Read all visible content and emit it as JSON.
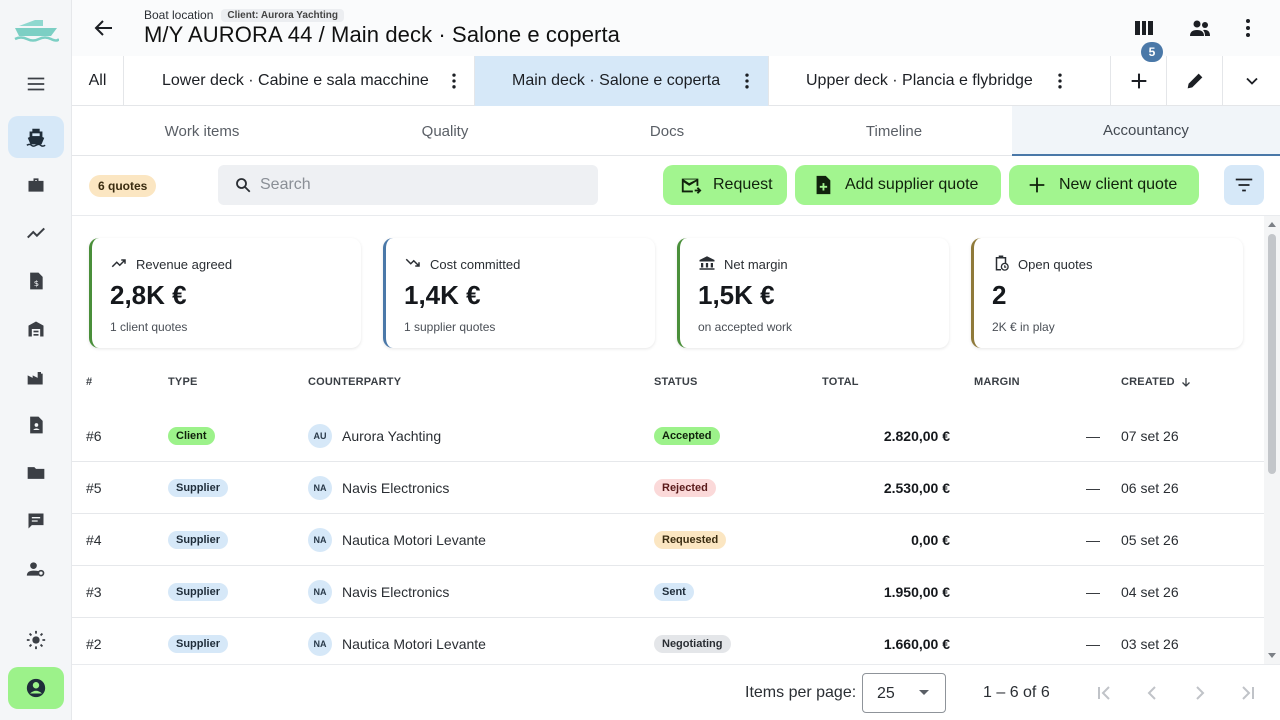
{
  "app": {
    "crumb": "Boat location",
    "client_chip": "Client: Aurora Yachting",
    "title": "M/Y AURORA 44 / Main deck · Salone e coperta",
    "notif_count": "5"
  },
  "sidebar": {
    "items": [
      {
        "icon": "menu-icon"
      },
      {
        "icon": "ship-icon",
        "active": true
      },
      {
        "icon": "briefcase-icon"
      },
      {
        "icon": "trending-icon"
      },
      {
        "icon": "invoice-icon"
      },
      {
        "icon": "warehouse-icon"
      },
      {
        "icon": "factory-icon"
      },
      {
        "icon": "contact-doc-icon"
      },
      {
        "icon": "folder-icon"
      },
      {
        "icon": "chat-icon"
      },
      {
        "icon": "user-settings-icon"
      },
      {
        "icon": "theme-icon"
      },
      {
        "icon": "account-icon"
      }
    ]
  },
  "decks": {
    "all_label": "All",
    "tabs": [
      {
        "label": "Lower deck · Cabine e sala macchine"
      },
      {
        "label": "Main deck · Salone e coperta",
        "active": true
      },
      {
        "label": "Upper deck · Plancia e flybridge"
      }
    ]
  },
  "sections": {
    "tabs": [
      {
        "label": "Work items"
      },
      {
        "label": "Quality"
      },
      {
        "label": "Docs"
      },
      {
        "label": "Timeline"
      },
      {
        "label": "Accountancy",
        "active": true
      }
    ]
  },
  "toolbar": {
    "count_label": "6 quotes",
    "search_placeholder": "Search",
    "request_label": "Request",
    "add_supplier_label": "Add supplier quote",
    "new_client_label": "New client quote"
  },
  "kpis": [
    {
      "title": "Revenue agreed",
      "value": "2,8K €",
      "sub": "1 client quotes",
      "icon": "trending-up-icon",
      "accent": "#4a8f3a"
    },
    {
      "title": "Cost committed",
      "value": "1,4K €",
      "sub": "1 supplier quotes",
      "icon": "trending-down-icon",
      "accent": "#4a78a8"
    },
    {
      "title": "Net margin",
      "value": "1,5K €",
      "sub": "on accepted work",
      "icon": "bank-icon",
      "accent": "#4a8f3a"
    },
    {
      "title": "Open quotes",
      "value": "2",
      "sub": "2K € in play",
      "icon": "clipboard-clock-icon",
      "accent": "#8f7a3a"
    }
  ],
  "table": {
    "headers": {
      "num": "#",
      "type": "TYPE",
      "counterparty": "COUNTERPARTY",
      "status": "STATUS",
      "total": "TOTAL",
      "margin": "MARGIN",
      "created": "CREATED"
    },
    "rows": [
      {
        "num": "#6",
        "type": "Client",
        "initials": "AU",
        "counterparty": "Aurora Yachting",
        "status": "Accepted",
        "total": "2.820,00 €",
        "margin": "—",
        "created": "07 set 26"
      },
      {
        "num": "#5",
        "type": "Supplier",
        "initials": "NA",
        "counterparty": "Navis Electronics",
        "status": "Rejected",
        "total": "2.530,00 €",
        "margin": "—",
        "created": "06 set 26"
      },
      {
        "num": "#4",
        "type": "Supplier",
        "initials": "NA",
        "counterparty": "Nautica Motori Levante",
        "status": "Requested",
        "total": "0,00 €",
        "margin": "—",
        "created": "05 set 26"
      },
      {
        "num": "#3",
        "type": "Supplier",
        "initials": "NA",
        "counterparty": "Navis Electronics",
        "status": "Sent",
        "total": "1.950,00 €",
        "margin": "—",
        "created": "04 set 26"
      },
      {
        "num": "#2",
        "type": "Supplier",
        "initials": "NA",
        "counterparty": "Nautica Motori Levante",
        "status": "Negotiating",
        "total": "1.660,00 €",
        "margin": "—",
        "created": "03 set 26"
      }
    ]
  },
  "paginator": {
    "items_per_page_label": "Items per page:",
    "items_per_page": "25",
    "range": "1 – 6 of 6"
  },
  "colors": {
    "accent_green": "#a2f58f",
    "accent_blue": "#d6e8f8",
    "status_accepted": "#9cf28a",
    "status_rejected": "#fbd9d9",
    "status_requested": "#fbe6c2",
    "status_sent": "#d6e8f8",
    "status_negotiating": "#e4e6e9"
  }
}
